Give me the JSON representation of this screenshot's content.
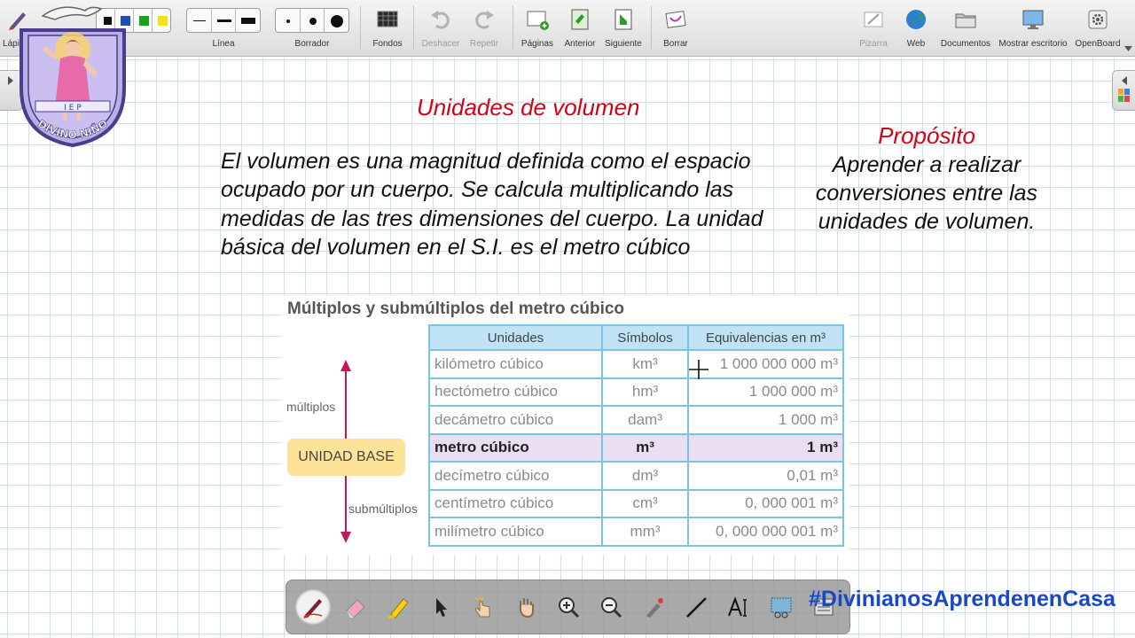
{
  "toolbar": {
    "pen_label": "Lápiz",
    "line_label": "Línea",
    "eraser_label": "Borrador",
    "backgrounds_label": "Fondos",
    "undo_label": "Deshacer",
    "redo_label": "Repetir",
    "pages_label": "Páginas",
    "previous_label": "Anterior",
    "next_label": "Siguiente",
    "clear_label": "Borrar",
    "board_label": "Pizarra",
    "web_label": "Web",
    "documents_label": "Documentos",
    "desktop_label": "Mostrar escritorio",
    "openboard_label": "OpenBoard",
    "pen_colors": [
      "#111111",
      "#1e4fb4",
      "#1aa31a",
      "#f5e11a"
    ]
  },
  "slide": {
    "title": "Unidades de volumen",
    "definition": "El volumen es una magnitud definida como el espacio ocupado por un cuerpo. Se calcula multiplicando las medidas de las tres dimensiones del cuerpo. La unidad básica del volumen en el S.I. es el metro cúbico",
    "purpose_title": "Propósito",
    "purpose_text": "Aprender a realizar conversiones entre las unidades de volumen."
  },
  "units_table": {
    "heading": "Múltiplos y submúltiplos del metro cúbico",
    "multiples_label": "múltiplos",
    "submultiples_label": "submúltiplos",
    "base_label": "UNIDAD BASE",
    "columns": [
      "Unidades",
      "Símbolos",
      "Equivalencias en m³"
    ],
    "rows": [
      {
        "unit": "kilómetro cúbico",
        "symbol": "km³",
        "equivalence": "1 000 000 000 m³"
      },
      {
        "unit": "hectómetro cúbico",
        "symbol": "hm³",
        "equivalence": "1 000 000 m³"
      },
      {
        "unit": "decámetro cúbico",
        "symbol": "dam³",
        "equivalence": "1 000 m³"
      },
      {
        "unit": "metro cúbico",
        "symbol": "m³",
        "equivalence": "1 m³"
      },
      {
        "unit": "decímetro cúbico",
        "symbol": "dm³",
        "equivalence": "0,01 m³"
      },
      {
        "unit": "centímetro cúbico",
        "symbol": "cm³",
        "equivalence": "0, 000 001 m³"
      },
      {
        "unit": "milímetro cúbico",
        "symbol": "mm³",
        "equivalence": "0, 000 000 001 m³"
      }
    ]
  },
  "logo": {
    "text": "DIVINO NIÑO",
    "letters": "I E P"
  },
  "hashtag": "#DivinianosAprendenenCasa",
  "colors": {
    "title_red": "#d0021b",
    "hashtag_blue": "#1848c8",
    "table_header": "#bfe3f5",
    "base_row": "#e9dff1",
    "base_badge": "#fde39a"
  }
}
